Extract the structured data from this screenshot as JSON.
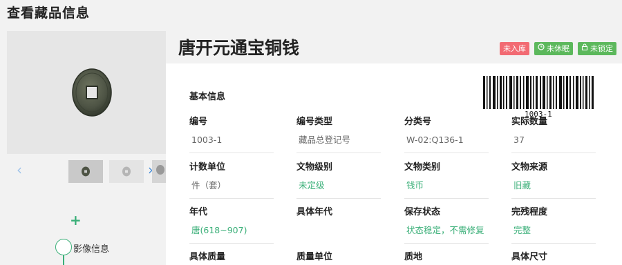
{
  "page": {
    "title": "查看藏品信息"
  },
  "item": {
    "name": "唐开元通宝铜钱",
    "tags": [
      {
        "label": "未入库",
        "color": "#f26b73",
        "icon": ""
      },
      {
        "label": "未休眠",
        "color": "#5cb85c",
        "icon": "clock-icon"
      },
      {
        "label": "未锁定",
        "color": "#5cb85c",
        "icon": "lock-icon"
      }
    ]
  },
  "gallery": {
    "prev_icon": "chevron-left-icon",
    "next_icon": "chevron-right-icon"
  },
  "timeline": {
    "add_icon": "plus-icon",
    "node_label": "影像信息"
  },
  "basic_info": {
    "section_title": "基本信息",
    "barcode_text": "1003-1",
    "fields": [
      {
        "label": "编号",
        "value": "1003-1"
      },
      {
        "label": "编号类型",
        "value": "藏品总登记号"
      },
      {
        "label": "分类号",
        "value": "W-02:Q136-1"
      },
      {
        "label": "实际数量",
        "value": "37"
      },
      {
        "label": "计数单位",
        "value": "件（套）"
      },
      {
        "label": "文物级别",
        "value": "未定级"
      },
      {
        "label": "文物类别",
        "value": "钱币"
      },
      {
        "label": "文物来源",
        "value": "旧藏"
      },
      {
        "label": "年代",
        "value": "唐(618~907)"
      },
      {
        "label": "具体年代",
        "value": ""
      },
      {
        "label": "保存状态",
        "value": "状态稳定，不需修复"
      },
      {
        "label": "完残程度",
        "value": "完整"
      },
      {
        "label": "具体质量",
        "value": ""
      },
      {
        "label": "质量单位",
        "value": ""
      },
      {
        "label": "质地",
        "value": ""
      },
      {
        "label": "具体尺寸",
        "value": ""
      }
    ]
  },
  "colors": {
    "accent_green": "#3aaf78",
    "link_blue": "#4a90d9",
    "tag_red": "#f26b73",
    "tag_green": "#5cb85c"
  }
}
